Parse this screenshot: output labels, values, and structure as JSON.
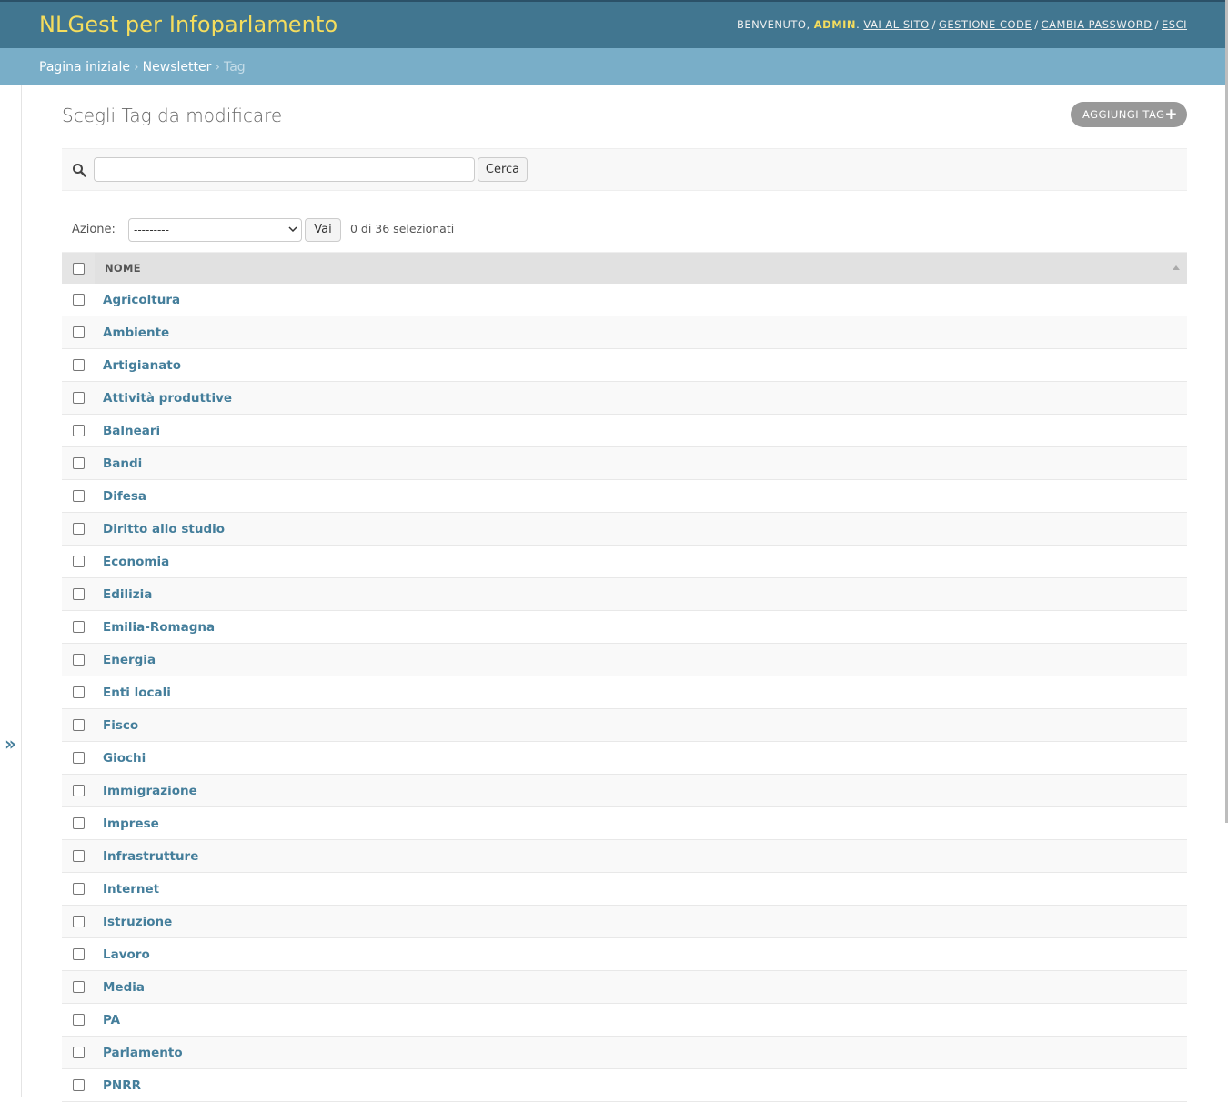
{
  "header": {
    "site_name": "NLGest per Infoparlamento",
    "welcome": "Benvenuto,",
    "user": "admin",
    "links": [
      "Vai al sito",
      "Gestione code",
      "Cambia password",
      "Esci"
    ]
  },
  "breadcrumbs": [
    "Pagina iniziale",
    "Newsletter",
    "Tag"
  ],
  "page": {
    "title": "Scegli Tag da modificare",
    "add_label": "AGGIUNGI TAG"
  },
  "search": {
    "value": "",
    "placeholder": "",
    "button": "Cerca"
  },
  "actions": {
    "label": "Azione:",
    "selected": "---------",
    "go": "Vai",
    "counter": "0 di 36 selezionati"
  },
  "table": {
    "column": "NOME",
    "rows": [
      "Agricoltura",
      "Ambiente",
      "Artigianato",
      "Attività produttive",
      "Balneari",
      "Bandi",
      "Difesa",
      "Diritto allo studio",
      "Economia",
      "Edilizia",
      "Emilia-Romagna",
      "Energia",
      "Enti locali",
      "Fisco",
      "Giochi",
      "Immigrazione",
      "Imprese",
      "Infrastrutture",
      "Internet",
      "Istruzione",
      "Lavoro",
      "Media",
      "PA",
      "Parlamento",
      "PNRR"
    ]
  },
  "colors": {
    "header": "#417690",
    "breadcrumbs": "#79aec8",
    "brand": "#f5dd5d",
    "link": "#447e9b"
  },
  "icons": {
    "search": "search-icon",
    "toggle_nav": "double-chevron-right-icon",
    "add": "plus-icon"
  },
  "nav_toggle": "»"
}
